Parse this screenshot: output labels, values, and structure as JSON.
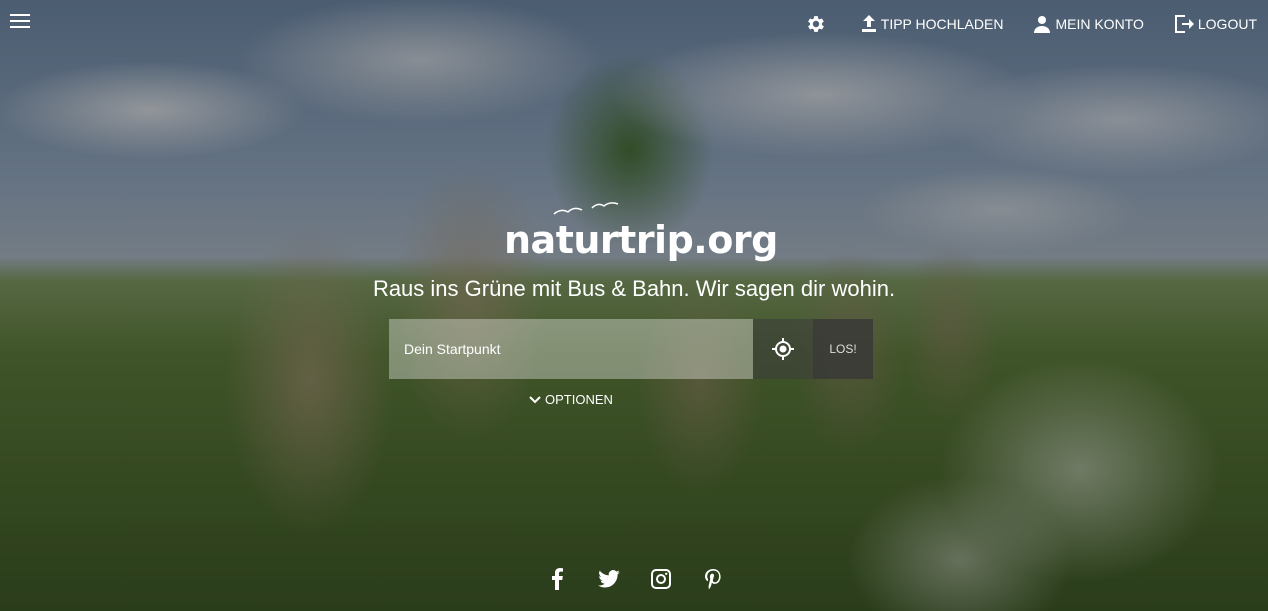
{
  "header": {
    "menu_icon": "hamburger-icon",
    "settings_icon": "gear-icon",
    "upload_label": "TIPP HOCHLADEN",
    "account_label": "MEIN KONTO",
    "logout_label": "LOGOUT"
  },
  "hero": {
    "logo_text": "naturtrip.org",
    "tagline": "Raus ins Grüne mit Bus & Bahn. Wir sagen dir wohin."
  },
  "search": {
    "placeholder": "Dein Startpunkt",
    "value": "",
    "locate_icon": "crosshair-icon",
    "submit_label": "LOS!",
    "options_label": "OPTIONEN"
  },
  "social": [
    "facebook-icon",
    "twitter-icon",
    "instagram-icon",
    "pinterest-icon"
  ]
}
